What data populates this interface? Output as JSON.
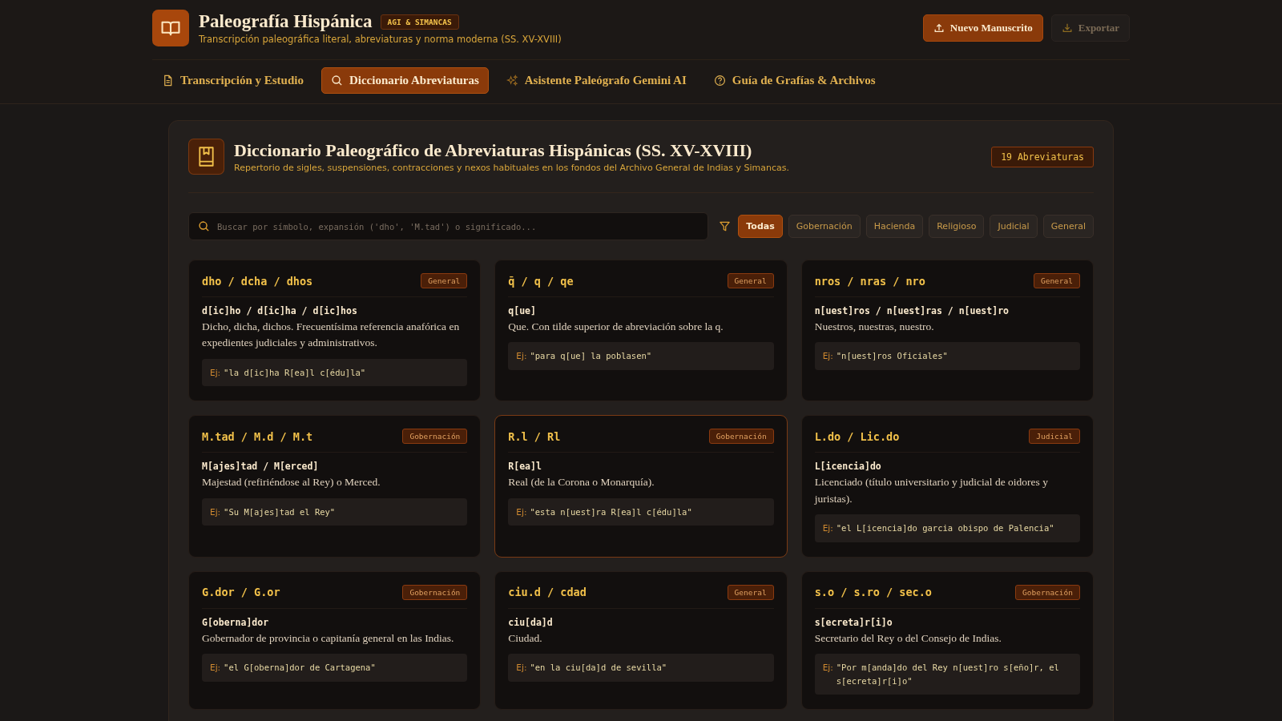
{
  "header": {
    "title": "Paleografía Hispánica",
    "badge": "AGI & SIMANCAS",
    "subtitle": "Transcripción paleográfica literal, abreviaturas y norma moderna (SS. XV-XVIII)",
    "actions": [
      {
        "kind": "primary",
        "label": "Nuevo Manuscrito"
      },
      {
        "kind": "secondary",
        "label": "Exportar"
      }
    ]
  },
  "tabs": [
    {
      "kind": "document",
      "label": "Transcripción y Estudio",
      "selected": false
    },
    {
      "kind": "search",
      "label": "Diccionario Abreviaturas",
      "selected": true
    },
    {
      "kind": "assistant",
      "label": "Asistente Paleógrafo Gemini AI",
      "selected": false
    },
    {
      "kind": "guide",
      "label": "Guía de Grafías & Archivos",
      "selected": false
    }
  ],
  "dictionary": {
    "title": "Diccionario Paleográfico de Abreviaturas Hispánicas (SS. XV-XVIII)",
    "subtitle": "Repertorio de sigles, suspensiones, contracciones y nexos habituales en los fondos del Archivo General de Indias y Simancas.",
    "count": "19 Abreviaturas",
    "search": {
      "placeholder": "Buscar por símbolo, expansión ('dho', 'M.tad') o significado..."
    },
    "filters": [
      {
        "label": "Todas",
        "selected": true
      },
      {
        "label": "Gobernación",
        "selected": false
      },
      {
        "label": "Hacienda",
        "selected": false
      },
      {
        "label": "Religioso",
        "selected": false
      },
      {
        "label": "Judicial",
        "selected": false
      },
      {
        "label": "General",
        "selected": false
      }
    ],
    "entries": [
      {
        "abbr": "dho / dcha / dhos",
        "category": "General",
        "expansion": "d[ic]ho / d[ic]ha / d[ic]hos",
        "meaning": "Dicho, dicha, dichos. Frecuentísima referencia anafórica en expedientes judiciales y administrativos.",
        "example_label": "Ej:",
        "example": "\"la d[ic]ha R[ea]l c[édu]la\"",
        "highlighted": false
      },
      {
        "abbr": "q̄ / q / qe",
        "category": "General",
        "expansion": "q[ue]",
        "meaning": "Que. Con tilde superior de abreviación sobre la q.",
        "example_label": "Ej:",
        "example": "\"para q[ue] la poblasen\"",
        "highlighted": false
      },
      {
        "abbr": "nros / nras / nro",
        "category": "General",
        "expansion": "n[uest]ros / n[uest]ras / n[uest]ro",
        "meaning": "Nuestros, nuestras, nuestro.",
        "example_label": "Ej:",
        "example": "\"n[uest]ros Oficiales\"",
        "highlighted": false
      },
      {
        "abbr": "M.tad / M.d / M.t",
        "category": "Gobernación",
        "expansion": "M[ajes]tad / M[erced]",
        "meaning": "Majestad (refiriéndose al Rey) o Merced.",
        "example_label": "Ej:",
        "example": "\"Su M[ajes]tad el Rey\"",
        "highlighted": false
      },
      {
        "abbr": "R.l / Rl",
        "category": "Gobernación",
        "expansion": "R[ea]l",
        "meaning": "Real (de la Corona o Monarquía).",
        "example_label": "Ej:",
        "example": "\"esta n[uest]ra R[ea]l c[édu]la\"",
        "highlighted": true
      },
      {
        "abbr": "L.do / Lic.do",
        "category": "Judicial",
        "expansion": "L[icencia]do",
        "meaning": "Licenciado (título universitario y judicial de oidores y juristas).",
        "example_label": "Ej:",
        "example": "\"el L[icencia]do garcia obispo de Palencia\"",
        "highlighted": false
      },
      {
        "abbr": "G.dor / G.or",
        "category": "Gobernación",
        "expansion": "G[oberna]dor",
        "meaning": "Gobernador de provincia o capitanía general en las Indias.",
        "example_label": "Ej:",
        "example": "\"el G[oberna]dor de Cartagena\"",
        "highlighted": false
      },
      {
        "abbr": "ciu.d / cdad",
        "category": "General",
        "expansion": "ciu[da]d",
        "meaning": "Ciudad.",
        "example_label": "Ej:",
        "example": "\"en la ciu[da]d de sevilla\"",
        "highlighted": false
      },
      {
        "abbr": "s.o / s.ro / sec.o",
        "category": "Gobernación",
        "expansion": "s[ecreta]r[i]o",
        "meaning": "Secretario del Rey o del Consejo de Indias.",
        "example_label": "Ej:",
        "example": "\"Por m[anda]do del Rey n[uest]ro s[eño]r, el s[ecreta]r[i]o\"",
        "highlighted": false
      }
    ]
  }
}
